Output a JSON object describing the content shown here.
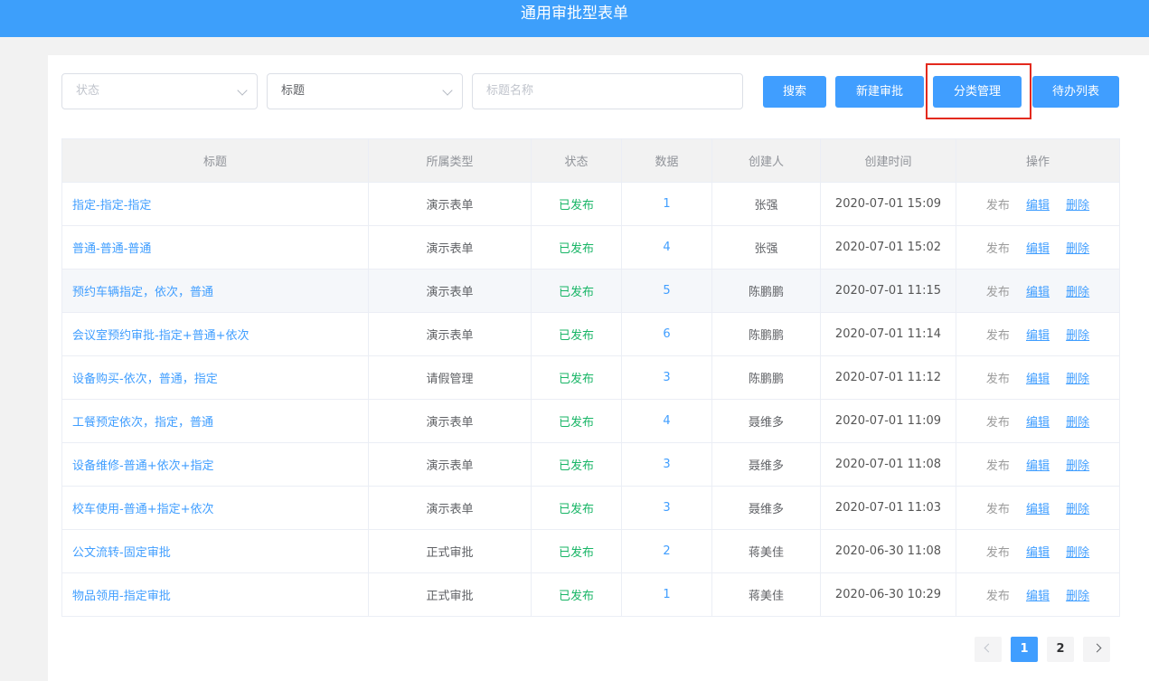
{
  "header": {
    "title": "通用审批型表单"
  },
  "filters": {
    "status_placeholder": "状态",
    "field_value": "标题",
    "name_placeholder": "标题名称"
  },
  "toolbar": {
    "search_label": "搜索",
    "new_label": "新建审批",
    "category_label": "分类管理",
    "todo_label": "待办列表"
  },
  "table": {
    "columns": [
      "标题",
      "所属类型",
      "状态",
      "数据",
      "创建人",
      "创建时间",
      "操作"
    ],
    "actions": {
      "publish": "发布",
      "edit": "编辑",
      "delete": "删除"
    },
    "rows": [
      {
        "title": "指定-指定-指定",
        "type": "演示表单",
        "status": "已发布",
        "count": "1",
        "creator": "张强",
        "created": "2020-07-01 15:09"
      },
      {
        "title": "普通-普通-普通",
        "type": "演示表单",
        "status": "已发布",
        "count": "4",
        "creator": "张强",
        "created": "2020-07-01 15:02"
      },
      {
        "title": "预约车辆指定，依次，普通",
        "type": "演示表单",
        "status": "已发布",
        "count": "5",
        "creator": "陈鹏鹏",
        "created": "2020-07-01 11:15"
      },
      {
        "title": "会议室预约审批-指定+普通+依次",
        "type": "演示表单",
        "status": "已发布",
        "count": "6",
        "creator": "陈鹏鹏",
        "created": "2020-07-01 11:14"
      },
      {
        "title": "设备购买-依次，普通，指定",
        "type": "请假管理",
        "status": "已发布",
        "count": "3",
        "creator": "陈鹏鹏",
        "created": "2020-07-01 11:12"
      },
      {
        "title": "工餐预定依次，指定，普通",
        "type": "演示表单",
        "status": "已发布",
        "count": "4",
        "creator": "聂维多",
        "created": "2020-07-01 11:09"
      },
      {
        "title": "设备维修-普通+依次+指定",
        "type": "演示表单",
        "status": "已发布",
        "count": "3",
        "creator": "聂维多",
        "created": "2020-07-01 11:08"
      },
      {
        "title": "校车使用-普通+指定+依次",
        "type": "演示表单",
        "status": "已发布",
        "count": "3",
        "creator": "聂维多",
        "created": "2020-07-01 11:03"
      },
      {
        "title": "公文流转-固定审批",
        "type": "正式审批",
        "status": "已发布",
        "count": "2",
        "creator": "蒋美佳",
        "created": "2020-06-30 11:08"
      },
      {
        "title": "物品领用-指定审批",
        "type": "正式审批",
        "status": "已发布",
        "count": "1",
        "creator": "蒋美佳",
        "created": "2020-06-30 10:29"
      }
    ]
  },
  "pagination": {
    "pages": [
      "1",
      "2"
    ],
    "current": "1"
  },
  "colors": {
    "header": "#3d9ffb",
    "primary": "#409eff",
    "published": "#18b566",
    "highlight_box": "#e3291d"
  },
  "icons": {
    "select_arrow": "chevron-down-icon",
    "prev": "chevron-left-icon",
    "next": "chevron-right-icon"
  }
}
